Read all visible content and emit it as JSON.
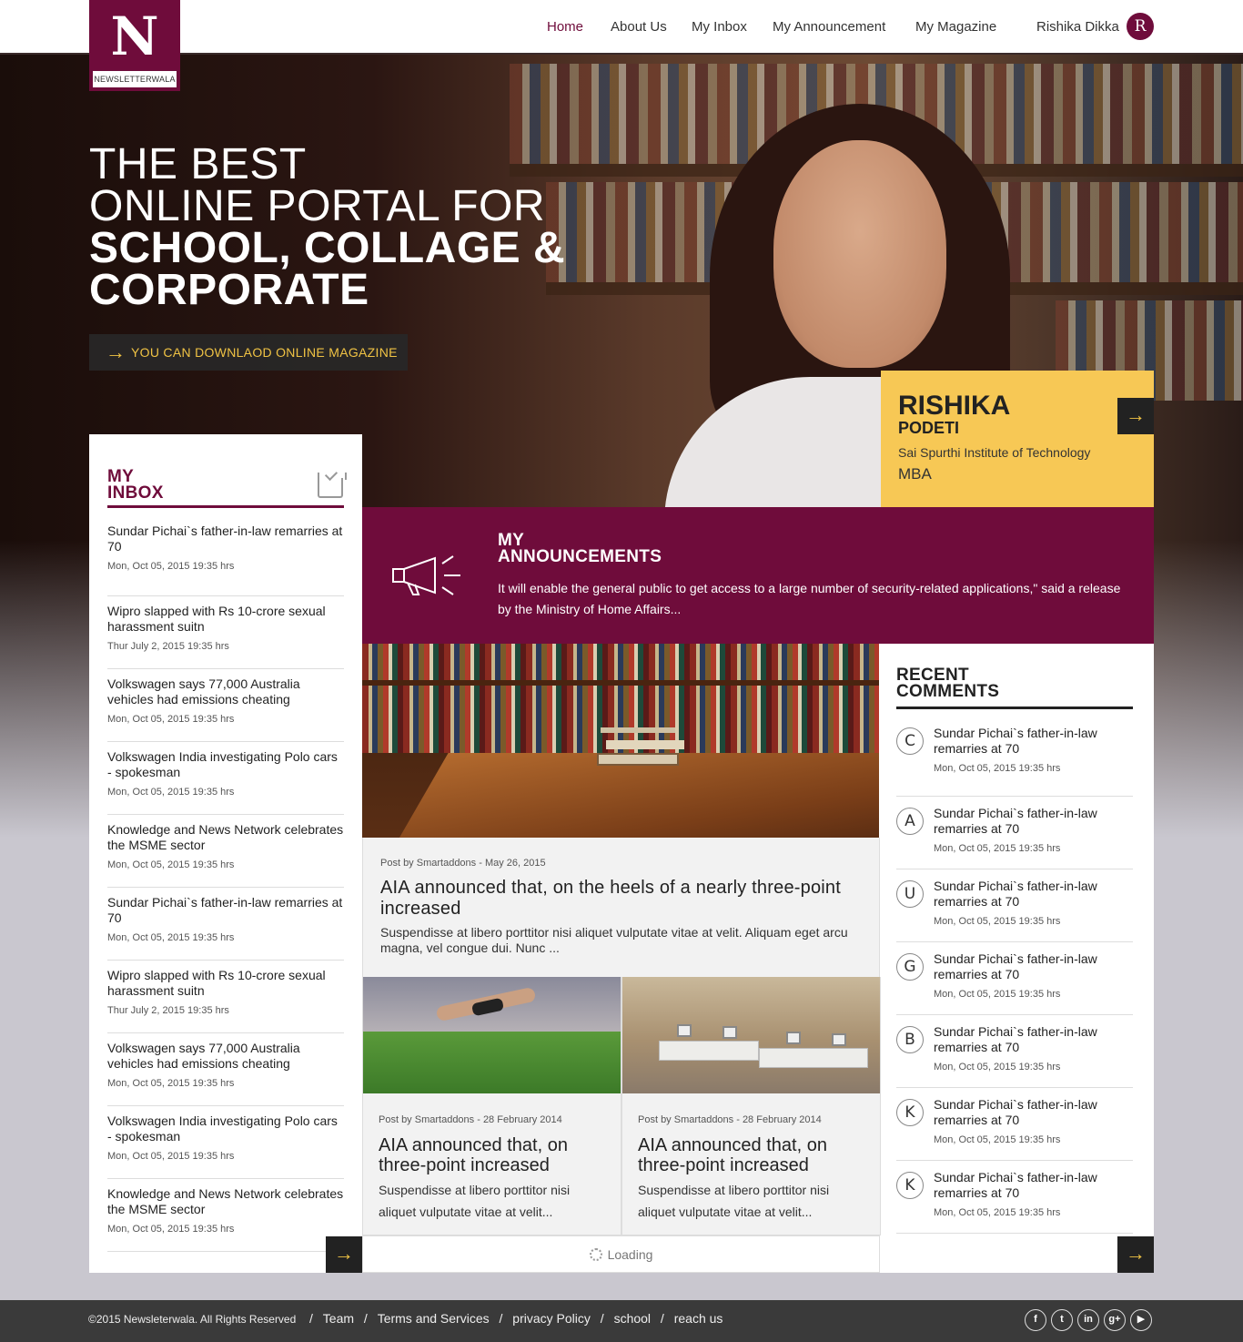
{
  "brand": {
    "letter": "N",
    "name": "NEWSLETTERWALA"
  },
  "nav": {
    "home": "Home",
    "about": "About Us",
    "inbox": "My Inbox",
    "announcement": "My Announcement",
    "magazine": "My Magazine",
    "user_name": "Rishika Dikka",
    "avatar_letter": "R"
  },
  "hero": {
    "line1": "THE BEST",
    "line2": "ONLINE PORTAL FOR",
    "line3": "SCHOOL, COLLAGE &",
    "line4": "CORPORATE",
    "download_label": "YOU CAN DOWNLAOD ONLINE MAGAZINE"
  },
  "profile": {
    "first_name": "RISHIKA",
    "last_name": "PODETI",
    "institute": "Sai Spurthi Institute of Technology",
    "degree": "MBA"
  },
  "inbox": {
    "title_line1": "MY",
    "title_line2": "INBOX",
    "items": [
      {
        "title": "Sundar Pichai`s father-in-law remarries at 70",
        "date": "Mon, Oct 05, 2015 19:35 hrs"
      },
      {
        "title": "Wipro slapped with Rs 10-crore sexual harassment suitn",
        "date": "Thur July 2, 2015 19:35 hrs"
      },
      {
        "title": "Volkswagen says 77,000 Australia vehicles had emissions cheating",
        "date": "Mon, Oct 05, 2015 19:35 hrs"
      },
      {
        "title": "Volkswagen India investigating Polo cars - spokesman",
        "date": "Mon, Oct 05, 2015 19:35 hrs"
      },
      {
        "title": "Knowledge and News Network celebrates the MSME sector",
        "date": "Mon, Oct 05, 2015 19:35 hrs"
      },
      {
        "title": "Sundar Pichai`s father-in-law remarries at 70",
        "date": "Mon, Oct 05, 2015 19:35 hrs"
      },
      {
        "title": "Wipro slapped with Rs 10-crore sexual harassment suitn",
        "date": "Thur July 2, 2015 19:35 hrs"
      },
      {
        "title": "Volkswagen says 77,000 Australia vehicles had emissions cheating",
        "date": "Mon, Oct 05, 2015 19:35 hrs"
      },
      {
        "title": "Volkswagen India investigating Polo cars - spokesman",
        "date": "Mon, Oct 05, 2015 19:35 hrs"
      },
      {
        "title": "Knowledge and News Network celebrates the MSME sector",
        "date": "Mon, Oct 05, 2015 19:35 hrs"
      }
    ]
  },
  "announcements": {
    "title_line1": "MY",
    "title_line2": "ANNOUNCEMENTS",
    "text": "It will enable the general public to get access to a large number of security-related applications,\" said a release by the Ministry of Home Affairs..."
  },
  "posts": {
    "featured": {
      "byline": "Post by Smartaddons - May 26, 2015",
      "title": "AIA announced that, on the heels of a nearly three-point increased",
      "excerpt": "Suspendisse at libero porttitor nisi aliquet vulputate vitae at velit. Aliquam eget arcu magna, vel congue dui. Nunc ..."
    },
    "small": [
      {
        "byline": "Post by Smartaddons - 28 February 2014",
        "title": "AIA announced that, on three-point increased",
        "excerpt": "Suspendisse at libero porttitor nisi aliquet vulputate vitae at velit..."
      },
      {
        "byline": "Post by Smartaddons - 28 February 2014",
        "title": "AIA announced that, on three-point increased",
        "excerpt": "Suspendisse at libero porttitor nisi aliquet vulputate vitae at velit..."
      }
    ],
    "loading_label": "Loading"
  },
  "comments": {
    "title_line1": "RECENT",
    "title_line2": "COMMENTS",
    "items": [
      {
        "letter": "C",
        "title": "Sundar Pichai`s father-in-law remarries at 70",
        "date": "Mon, Oct 05, 2015 19:35 hrs"
      },
      {
        "letter": "A",
        "title": "Sundar Pichai`s father-in-law remarries at 70",
        "date": "Mon, Oct 05, 2015 19:35 hrs"
      },
      {
        "letter": "U",
        "title": "Sundar Pichai`s father-in-law remarries at 70",
        "date": "Mon, Oct 05, 2015 19:35 hrs"
      },
      {
        "letter": "G",
        "title": "Sundar Pichai`s father-in-law remarries at 70",
        "date": "Mon, Oct 05, 2015 19:35 hrs"
      },
      {
        "letter": "B",
        "title": "Sundar Pichai`s father-in-law remarries at 70",
        "date": "Mon, Oct 05, 2015 19:35 hrs"
      },
      {
        "letter": "K",
        "title": "Sundar Pichai`s father-in-law remarries at 70",
        "date": "Mon, Oct 05, 2015 19:35 hrs"
      },
      {
        "letter": "K",
        "title": "Sundar Pichai`s father-in-law remarries at 70",
        "date": "Mon, Oct 05, 2015 19:35 hrs"
      }
    ]
  },
  "footer": {
    "copyright": "©2015 Newsleterwala. All Rights Reserved",
    "links": [
      "Team",
      "Terms and Services",
      "privacy Policy",
      "school",
      "reach us"
    ],
    "social": [
      {
        "icon": "facebook-icon",
        "glyph": "f"
      },
      {
        "icon": "twitter-icon",
        "glyph": "t"
      },
      {
        "icon": "linkedin-icon",
        "glyph": "in"
      },
      {
        "icon": "googleplus-icon",
        "glyph": "g+"
      },
      {
        "icon": "youtube-icon",
        "glyph": "▶"
      }
    ]
  },
  "colors": {
    "brand": "#6f0c3b",
    "accent": "#f7c855",
    "footer": "#3a3a3a"
  }
}
